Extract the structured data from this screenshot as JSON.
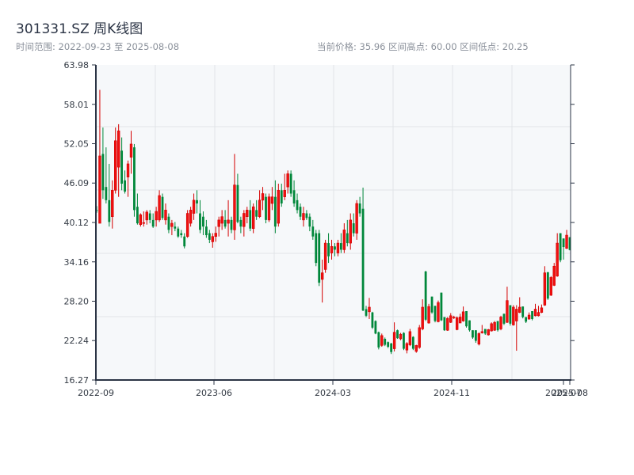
{
  "header": {
    "title": "301331.SZ 周K线图",
    "range_text": "时间范围: 2022-09-23 至 2025-08-08",
    "stats_text": "当前价格: 35.96  区间高点: 60.00  区间低点: 20.25"
  },
  "chart_data": {
    "type": "candlestick",
    "title": "301331.SZ 周K线图",
    "start_date": "2022-09-23",
    "end_date": "2025-08-08",
    "current_price": 35.96,
    "range_high": 60.0,
    "range_low": 20.25,
    "ylim": [
      16.27,
      63.98
    ],
    "y_ticks": [
      "63.98",
      "58.01",
      "52.05",
      "46.09",
      "40.12",
      "34.16",
      "28.20",
      "22.24",
      "16.27"
    ],
    "x_ticks": [
      "2022-09",
      "2023-06",
      "2024-03",
      "2024-11",
      "2025-07",
      "2025-08"
    ],
    "grid": true,
    "colors": {
      "up": "#d40000",
      "down": "#00873a",
      "plot_bg": "#f6f8fa",
      "grid": "#e1e4e8",
      "axis": "#2b3445"
    },
    "ohlc_fields": [
      "open",
      "high",
      "low",
      "close"
    ],
    "candles": [
      [
        42.0,
        42.6,
        41.6,
        41.9
      ],
      [
        40.0,
        60.2,
        40.0,
        50.2
      ],
      [
        50.5,
        54.5,
        43.7,
        45.0
      ],
      [
        45.5,
        51.5,
        43.0,
        43.5
      ],
      [
        43.5,
        49.0,
        39.5,
        40.2
      ],
      [
        41.0,
        46.5,
        39.2,
        45.0
      ],
      [
        45.0,
        54.5,
        44.5,
        52.5
      ],
      [
        48.5,
        55.0,
        44.0,
        54.0
      ],
      [
        51.0,
        53.0,
        45.0,
        46.0
      ],
      [
        46.5,
        48.0,
        44.5,
        44.8
      ],
      [
        47.0,
        49.5,
        44.0,
        49.0
      ],
      [
        50.0,
        54.0,
        47.5,
        52.0
      ],
      [
        51.5,
        52.0,
        41.0,
        42.0
      ],
      [
        42.5,
        44.5,
        39.8,
        40.0
      ],
      [
        39.8,
        41.5,
        39.5,
        41.3
      ],
      [
        40.0,
        41.8,
        39.5,
        40.1
      ],
      [
        40.5,
        42.0,
        39.8,
        41.7
      ],
      [
        41.5,
        42.0,
        40.0,
        40.5
      ],
      [
        40.5,
        41.5,
        39.3,
        39.5
      ],
      [
        40.5,
        42.5,
        39.5,
        41.8
      ],
      [
        40.5,
        45.0,
        40.2,
        44.2
      ],
      [
        44.0,
        44.5,
        40.5,
        40.8
      ],
      [
        40.5,
        43.0,
        39.8,
        42.0
      ],
      [
        41.0,
        41.5,
        38.5,
        39.0
      ],
      [
        39.5,
        40.5,
        38.2,
        40.0
      ],
      [
        39.5,
        40.2,
        38.8,
        39.2
      ],
      [
        39.2,
        39.5,
        37.8,
        38.0
      ],
      [
        38.5,
        39.0,
        37.8,
        38.2
      ],
      [
        38.0,
        38.5,
        36.2,
        36.5
      ],
      [
        38.0,
        42.0,
        37.8,
        41.5
      ],
      [
        40.0,
        42.5,
        39.5,
        42.0
      ],
      [
        41.5,
        44.5,
        40.5,
        43.5
      ],
      [
        43.5,
        45.0,
        41.5,
        43.0
      ],
      [
        41.5,
        43.5,
        38.5,
        39.0
      ],
      [
        41.0,
        41.8,
        38.2,
        39.5
      ],
      [
        39.5,
        40.5,
        37.8,
        38.2
      ],
      [
        38.5,
        39.0,
        37.0,
        37.5
      ],
      [
        37.2,
        38.5,
        36.3,
        38.0
      ],
      [
        38.0,
        39.5,
        37.2,
        38.5
      ],
      [
        39.5,
        41.0,
        38.0,
        40.5
      ],
      [
        40.0,
        42.0,
        39.0,
        41.0
      ],
      [
        40.5,
        42.0,
        39.2,
        39.5
      ],
      [
        40.0,
        43.5,
        38.0,
        40.5
      ],
      [
        40.5,
        41.0,
        38.5,
        39.0
      ],
      [
        39.0,
        50.5,
        37.5,
        45.8
      ],
      [
        45.8,
        47.5,
        40.0,
        40.2
      ],
      [
        40.5,
        41.0,
        38.5,
        39.5
      ],
      [
        39.5,
        42.0,
        38.0,
        41.5
      ],
      [
        41.0,
        42.5,
        40.0,
        42.0
      ],
      [
        42.0,
        43.5,
        38.8,
        39.2
      ],
      [
        39.2,
        43.0,
        38.5,
        42.5
      ],
      [
        42.0,
        43.5,
        40.5,
        41.0
      ],
      [
        41.0,
        45.0,
        40.8,
        43.5
      ],
      [
        43.5,
        45.5,
        42.0,
        44.5
      ],
      [
        44.0,
        44.5,
        40.0,
        40.5
      ],
      [
        40.5,
        44.5,
        40.2,
        44.0
      ],
      [
        43.0,
        45.5,
        42.0,
        44.0
      ],
      [
        44.0,
        46.5,
        38.5,
        39.5
      ],
      [
        40.0,
        46.0,
        39.5,
        45.0
      ],
      [
        45.0,
        46.0,
        42.5,
        43.0
      ],
      [
        44.0,
        47.5,
        43.5,
        45.0
      ],
      [
        45.5,
        48.0,
        44.5,
        47.5
      ],
      [
        47.5,
        48.0,
        44.0,
        44.5
      ],
      [
        45.0,
        46.5,
        42.5,
        43.0
      ],
      [
        43.5,
        44.5,
        41.5,
        42.0
      ],
      [
        42.5,
        43.0,
        40.5,
        41.0
      ],
      [
        40.5,
        42.5,
        39.5,
        41.5
      ],
      [
        41.5,
        42.0,
        40.5,
        40.8
      ],
      [
        41.0,
        41.5,
        38.8,
        39.5
      ],
      [
        39.5,
        40.5,
        37.5,
        38.0
      ],
      [
        38.5,
        39.0,
        33.5,
        34.0
      ],
      [
        38.5,
        39.0,
        30.5,
        31.0
      ],
      [
        31.5,
        34.5,
        28.0,
        32.5
      ],
      [
        33.0,
        37.5,
        32.5,
        37.0
      ],
      [
        37.0,
        38.5,
        34.0,
        35.0
      ],
      [
        35.5,
        37.5,
        34.5,
        36.5
      ],
      [
        36.5,
        37.0,
        35.0,
        36.0
      ],
      [
        35.5,
        37.5,
        35.0,
        37.0
      ],
      [
        37.0,
        38.5,
        35.5,
        36.0
      ],
      [
        36.0,
        40.0,
        35.5,
        39.0
      ],
      [
        38.5,
        40.5,
        36.5,
        37.0
      ],
      [
        37.0,
        41.5,
        36.0,
        40.5
      ],
      [
        40.0,
        41.5,
        38.0,
        38.5
      ],
      [
        38.5,
        43.5,
        37.5,
        43.0
      ],
      [
        43.0,
        44.0,
        41.0,
        41.5
      ],
      [
        42.2,
        45.4,
        26.7,
        26.8
      ],
      [
        27.0,
        27.5,
        25.8,
        26.0
      ],
      [
        26.6,
        28.7,
        25.5,
        27.3
      ],
      [
        26.5,
        26.6,
        24.0,
        24.2
      ],
      [
        25.2,
        25.3,
        23.2,
        23.3
      ],
      [
        23.5,
        23.6,
        20.9,
        21.2
      ],
      [
        21.5,
        23.3,
        21.3,
        23.0
      ],
      [
        22.5,
        22.7,
        21.4,
        21.6
      ],
      [
        22.0,
        22.1,
        21.1,
        21.3
      ],
      [
        21.8,
        21.9,
        20.2,
        20.5
      ],
      [
        21.0,
        25.0,
        20.6,
        23.5
      ],
      [
        23.8,
        23.9,
        22.5,
        22.6
      ],
      [
        22.5,
        23.4,
        22.3,
        23.2
      ],
      [
        23.4,
        23.5,
        20.8,
        21.0
      ],
      [
        20.8,
        22.0,
        20.3,
        21.8
      ],
      [
        21.6,
        24.0,
        21.4,
        23.6
      ],
      [
        22.8,
        22.9,
        20.8,
        21.0
      ],
      [
        20.6,
        21.6,
        20.4,
        21.5
      ],
      [
        21.2,
        24.6,
        21.0,
        24.2
      ],
      [
        24.0,
        28.5,
        23.8,
        27.3
      ],
      [
        32.7,
        32.8,
        25.2,
        25.4
      ],
      [
        24.9,
        27.8,
        24.8,
        27.4
      ],
      [
        28.9,
        28.9,
        26.3,
        26.5
      ],
      [
        27.5,
        27.5,
        25.0,
        25.2
      ],
      [
        25.1,
        28.3,
        25.0,
        28.0
      ],
      [
        29.5,
        29.5,
        25.2,
        25.3
      ],
      [
        25.8,
        25.8,
        23.7,
        23.8
      ],
      [
        23.8,
        25.8,
        23.7,
        25.6
      ],
      [
        25.0,
        26.4,
        24.9,
        26.0
      ],
      [
        25.7,
        26.0,
        25.5,
        25.8
      ],
      [
        23.9,
        25.9,
        23.8,
        25.7
      ],
      [
        24.9,
        26.3,
        24.9,
        25.8
      ],
      [
        25.2,
        27.4,
        25.1,
        26.6
      ],
      [
        26.7,
        26.7,
        24.2,
        24.4
      ],
      [
        25.3,
        25.3,
        23.6,
        23.8
      ],
      [
        23.8,
        23.8,
        22.5,
        22.7
      ],
      [
        23.8,
        23.8,
        21.9,
        22.2
      ],
      [
        21.7,
        23.5,
        21.5,
        23.3
      ],
      [
        23.4,
        24.6,
        23.3,
        23.6
      ],
      [
        24.0,
        24.0,
        23.1,
        23.3
      ],
      [
        23.1,
        24.0,
        23.0,
        23.9
      ],
      [
        23.7,
        25.0,
        23.6,
        24.8
      ],
      [
        23.8,
        25.2,
        23.7,
        25.0
      ],
      [
        25.2,
        25.2,
        23.6,
        23.8
      ],
      [
        24.0,
        26.0,
        23.8,
        25.8
      ],
      [
        26.3,
        26.3,
        24.6,
        24.8
      ],
      [
        25.0,
        30.4,
        24.9,
        28.3
      ],
      [
        27.6,
        27.6,
        24.5,
        24.8
      ],
      [
        24.6,
        27.6,
        24.5,
        27.3
      ],
      [
        25.2,
        27.6,
        20.7,
        27.0
      ],
      [
        26.5,
        28.8,
        26.4,
        27.3
      ],
      [
        27.4,
        27.4,
        25.6,
        25.8
      ],
      [
        25.8,
        25.8,
        24.9,
        25.1
      ],
      [
        25.5,
        26.5,
        25.4,
        26.1
      ],
      [
        26.7,
        26.7,
        25.3,
        25.5
      ],
      [
        26.0,
        27.8,
        25.9,
        27.0
      ],
      [
        26.0,
        27.5,
        25.9,
        26.5
      ],
      [
        26.5,
        27.7,
        26.4,
        27.2
      ],
      [
        27.6,
        33.5,
        27.5,
        32.5
      ],
      [
        32.6,
        32.6,
        28.4,
        28.6
      ],
      [
        29.1,
        32.0,
        29.0,
        31.8
      ],
      [
        30.6,
        34.0,
        30.5,
        33.5
      ],
      [
        32.0,
        38.5,
        31.9,
        37.0
      ],
      [
        38.5,
        38.5,
        34.1,
        34.4
      ],
      [
        37.7,
        37.7,
        34.5,
        36.4
      ],
      [
        36.2,
        39.0,
        36.1,
        38.2
      ],
      [
        37.9,
        37.9,
        35.9,
        35.96
      ]
    ]
  }
}
